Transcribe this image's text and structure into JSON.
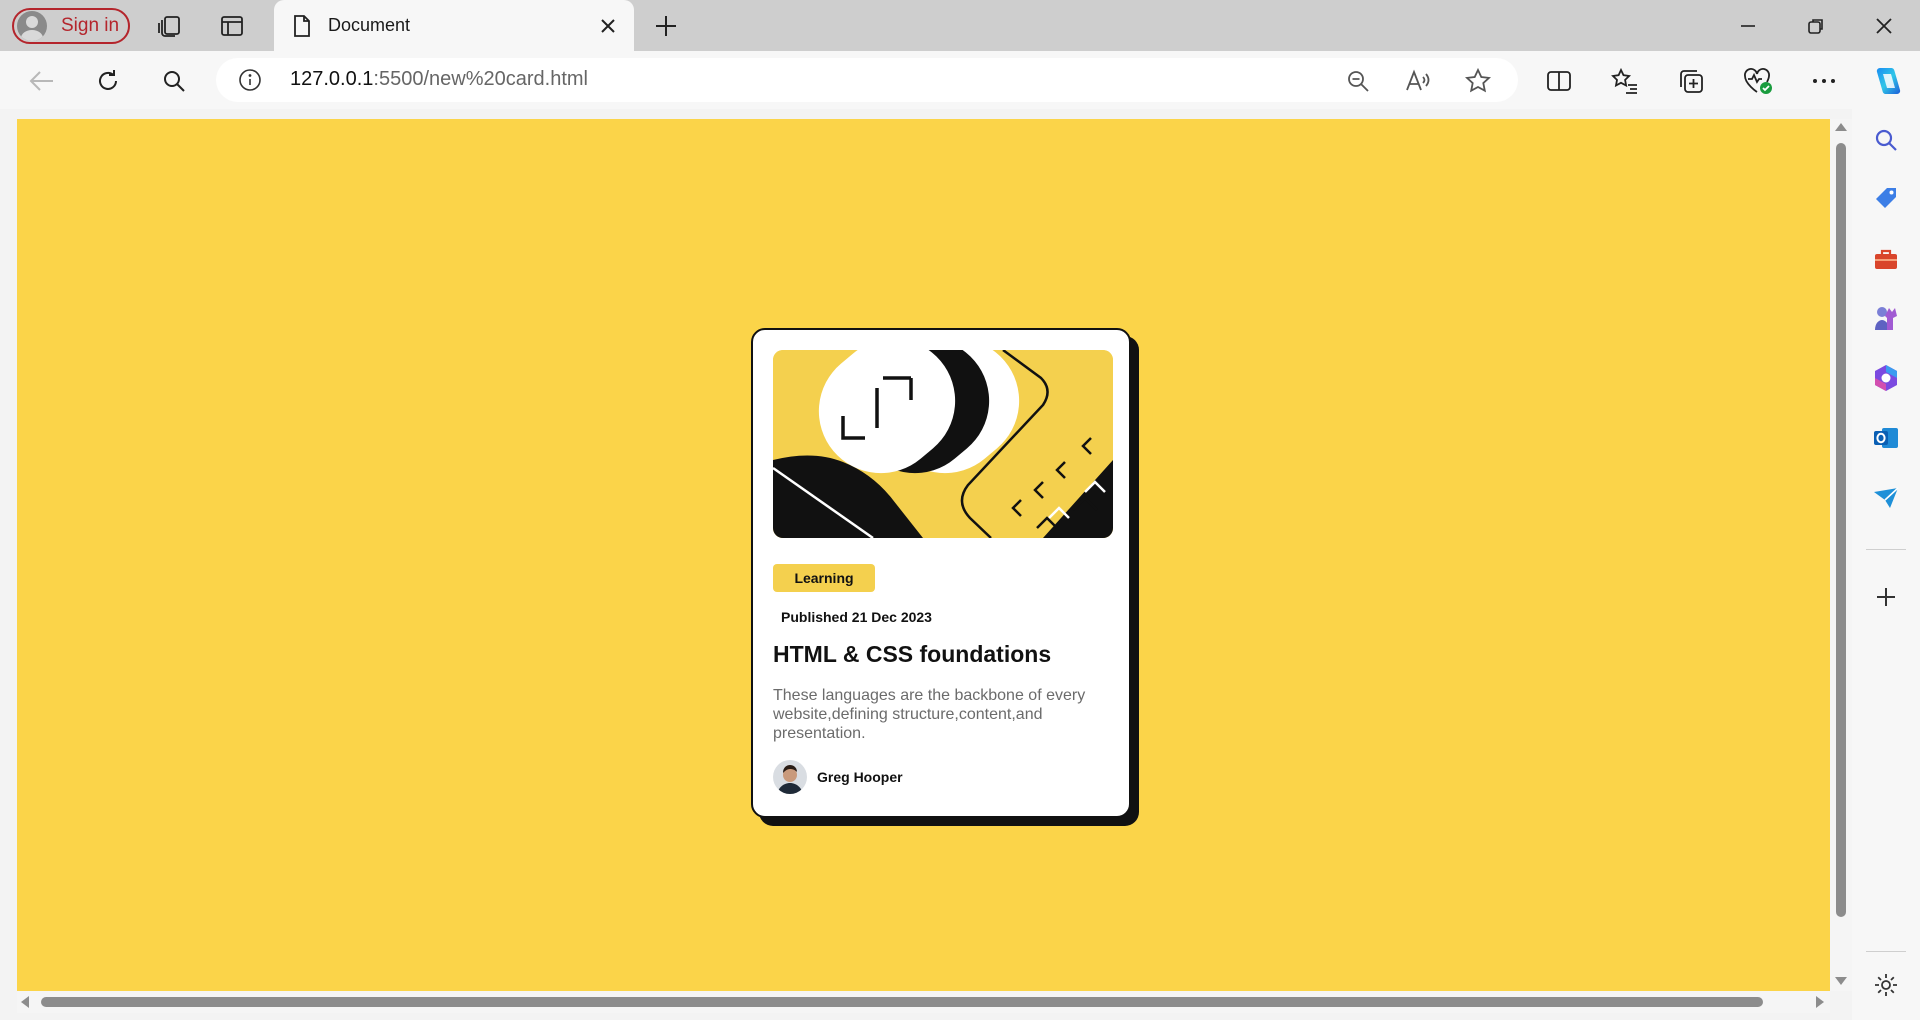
{
  "browser": {
    "signin_label": "Sign in",
    "tab_title": "Document",
    "url_host": "127.0.0.1",
    "url_rest": ":5500/new%20card.html"
  },
  "card": {
    "tag": "Learning",
    "published": "Published 21 Dec 2023",
    "title": "HTML & CSS foundations",
    "description": "These languages are the backbone of every website,defining structure,content,and presentation.",
    "author": "Greg Hooper"
  },
  "colors": {
    "page_background": "#fbd449",
    "accent_yellow": "#f4d04e",
    "card_border": "#111111",
    "signin_red": "#b4252c"
  }
}
